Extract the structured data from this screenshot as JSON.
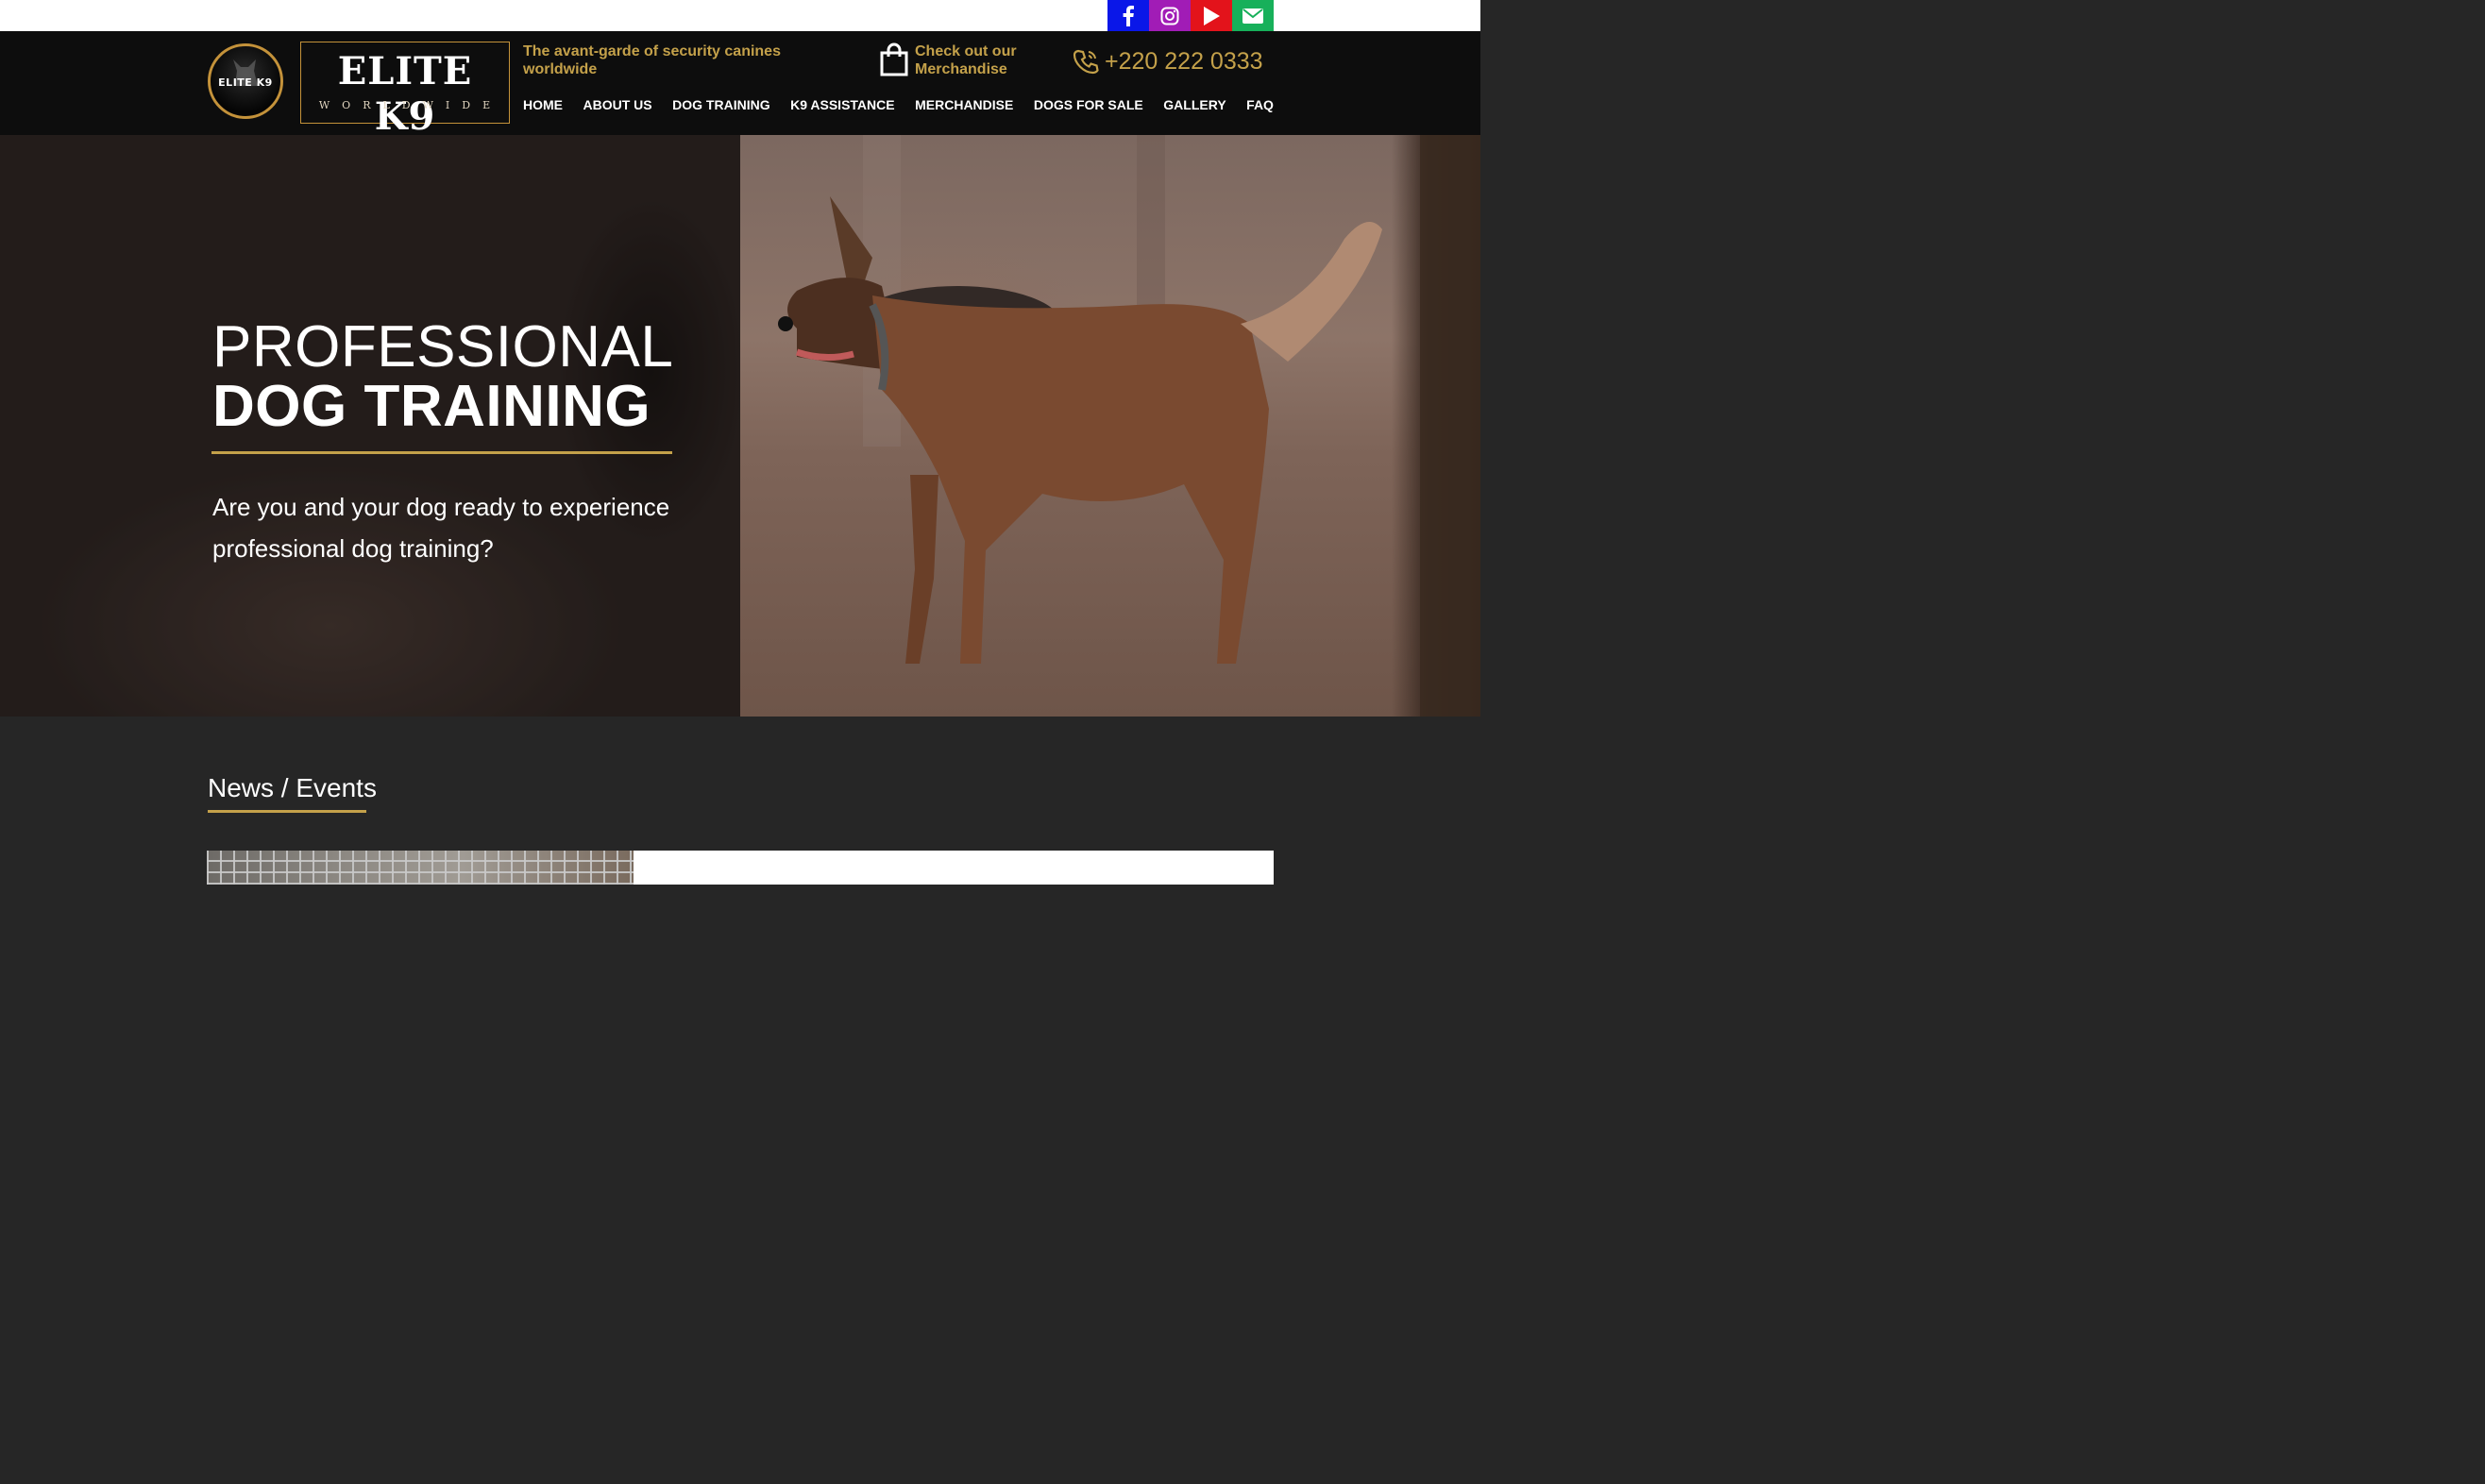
{
  "social": {
    "icons": [
      "facebook-icon",
      "instagram-icon",
      "youtube-icon",
      "email-icon"
    ],
    "colors": {
      "facebook": "#0a17e8",
      "instagram": "#a11cb6",
      "youtube": "#e3131b",
      "email": "#17b05a"
    }
  },
  "header": {
    "logo_circle_text": "ELITE K9",
    "logo_title": "ELITE K9",
    "logo_subtitle": "WORLDWIDE",
    "tagline": "The avant-garde of security canines worldwide",
    "merch_text": "Check out our Merchandise",
    "phone": "+220 222 0333",
    "accent_color": "#c4a14a"
  },
  "nav": {
    "items": [
      {
        "label": "HOME"
      },
      {
        "label": "ABOUT US"
      },
      {
        "label": "DOG TRAINING"
      },
      {
        "label": "K9 ASSISTANCE"
      },
      {
        "label": "MERCHANDISE"
      },
      {
        "label": "DOGS FOR SALE"
      },
      {
        "label": "GALLERY"
      },
      {
        "label": "FAQ"
      }
    ]
  },
  "hero": {
    "title_light": "PROFESSIONAL",
    "title_bold": "DOG TRAINING",
    "subtitle": "Are you and your dog ready to experience professional dog training?"
  },
  "news": {
    "title": "News / Events"
  }
}
